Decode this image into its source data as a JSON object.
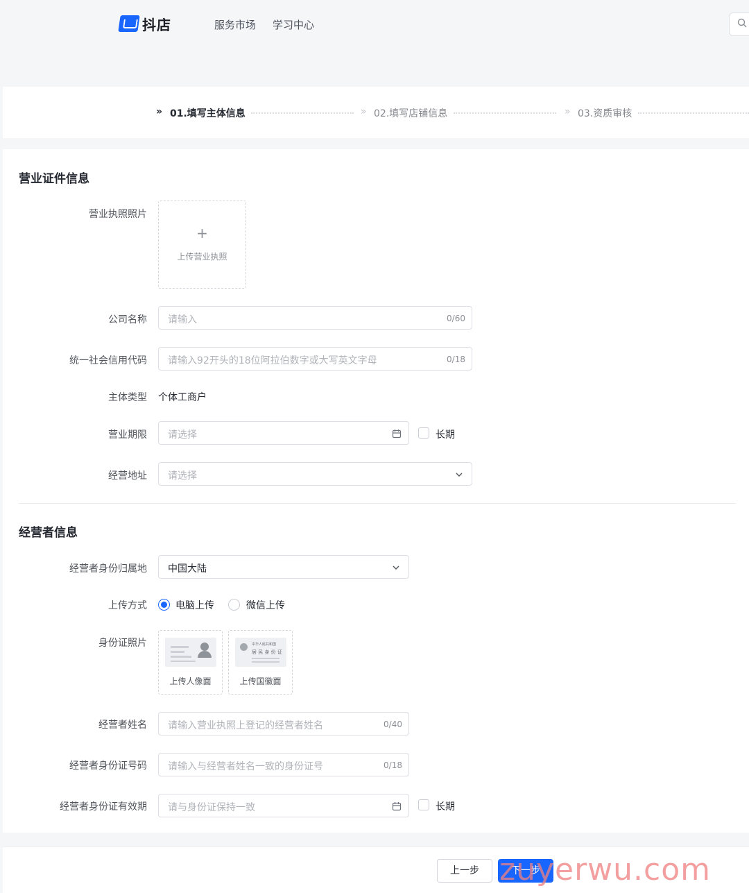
{
  "header": {
    "logo_text": "抖店",
    "nav": [
      "服务市场",
      "学习中心"
    ]
  },
  "steps": [
    {
      "label": "01.填写主体信息",
      "state": "active"
    },
    {
      "label": "02.填写店铺信息",
      "state": "inactive"
    },
    {
      "label": "03.资质审核",
      "state": "inactive"
    }
  ],
  "license_section": {
    "title": "营业证件信息",
    "photo": {
      "label": "营业执照照片",
      "upload_text": "上传营业执照"
    },
    "company_name": {
      "label": "公司名称",
      "placeholder": "请输入",
      "count": "0/60"
    },
    "credit_code": {
      "label": "统一社会信用代码",
      "placeholder": "请输入92开头的18位阿拉伯数字或大写英文字母",
      "count": "0/18"
    },
    "entity_type": {
      "label": "主体类型",
      "value": "个体工商户"
    },
    "business_term": {
      "label": "营业期限",
      "placeholder": "请选择",
      "long_term": "长期"
    },
    "address": {
      "label": "经营地址",
      "placeholder": "请选择"
    }
  },
  "operator_section": {
    "title": "经营者信息",
    "id_region": {
      "label": "经营者身份归属地",
      "value": "中国大陆"
    },
    "upload_method": {
      "label": "上传方式",
      "options": [
        "电脑上传",
        "微信上传"
      ],
      "selected": "电脑上传"
    },
    "id_photo": {
      "label": "身份证照片",
      "front": "上传人像面",
      "back": "上传国徽面",
      "card_line1": "中华人民共和国",
      "card_line2": "居 民 身 份 证"
    },
    "name": {
      "label": "经营者姓名",
      "placeholder": "请输入营业执照上登记的经营者姓名",
      "count": "0/40"
    },
    "id_number": {
      "label": "经营者身份证号码",
      "placeholder": "请输入与经营者姓名一致的身份证号",
      "count": "0/18"
    },
    "id_validity": {
      "label": "经营者身份证有效期",
      "placeholder": "请与身份证保持一致",
      "long_term": "长期"
    }
  },
  "footer": {
    "prev": "上一步",
    "next": "下一步"
  },
  "watermark": "zuyerwu.com",
  "colors": {
    "accent": "#1966ff",
    "watermark": "#f08080"
  }
}
